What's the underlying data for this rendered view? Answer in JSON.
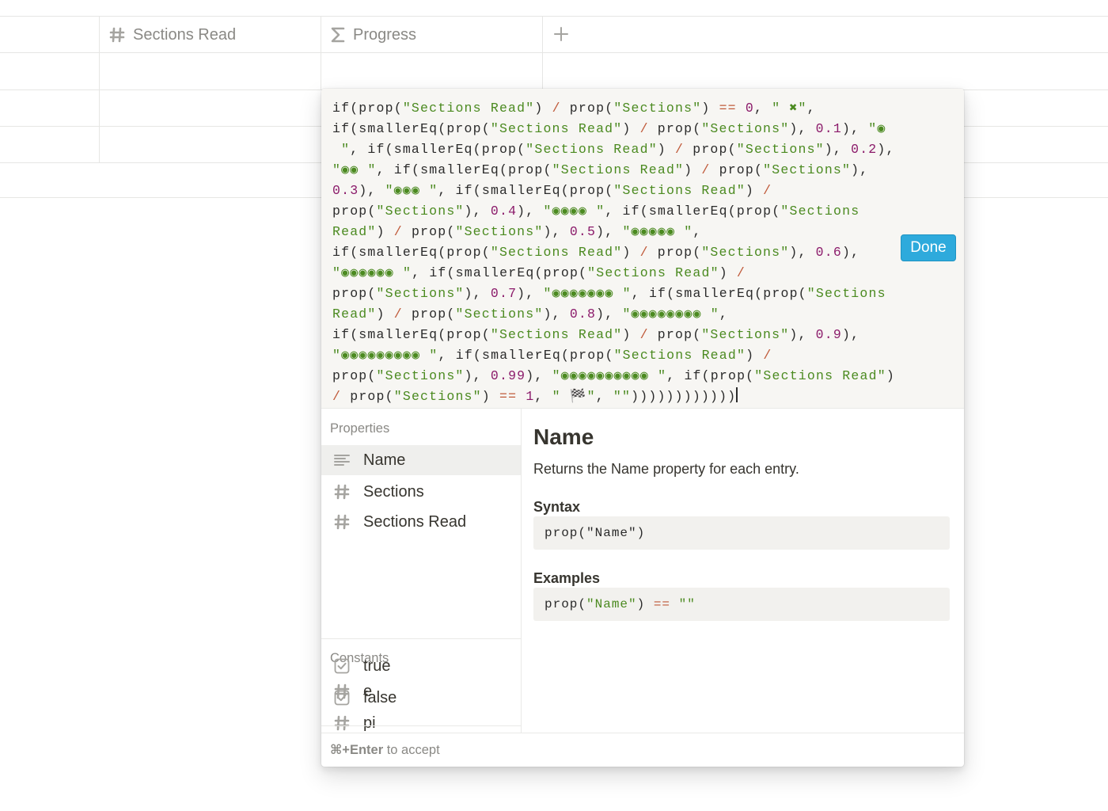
{
  "table": {
    "columns": [
      {
        "icon": "hash-icon",
        "label": "Sections Read"
      },
      {
        "icon": "sigma-icon",
        "label": "Progress"
      }
    ],
    "add_column_icon": "plus-icon"
  },
  "formula": {
    "lines": [
      [
        [
          "f",
          "if(prop("
        ],
        [
          "s",
          "\"Sections Read\""
        ],
        [
          "f",
          ") "
        ],
        [
          "o",
          "/"
        ],
        [
          "f",
          " prop("
        ],
        [
          "s",
          "\"Sections\""
        ],
        [
          "f",
          ") "
        ],
        [
          "o",
          "=="
        ],
        [
          "f",
          " "
        ],
        [
          "n",
          "0"
        ],
        [
          "f",
          ", "
        ],
        [
          "s",
          "\" ✖\""
        ],
        [
          "f",
          ","
        ]
      ],
      [
        [
          "f",
          "if(smallerEq(prop("
        ],
        [
          "s",
          "\"Sections Read\""
        ],
        [
          "f",
          ") "
        ],
        [
          "o",
          "/"
        ],
        [
          "f",
          " prop("
        ],
        [
          "s",
          "\"Sections\""
        ],
        [
          "f",
          "), "
        ],
        [
          "n",
          "0.1"
        ],
        [
          "f",
          "), "
        ],
        [
          "s",
          "\"◉"
        ]
      ],
      [
        [
          "s",
          " \""
        ],
        [
          "f",
          ", if(smallerEq(prop("
        ],
        [
          "s",
          "\"Sections Read\""
        ],
        [
          "f",
          ") "
        ],
        [
          "o",
          "/"
        ],
        [
          "f",
          " prop("
        ],
        [
          "s",
          "\"Sections\""
        ],
        [
          "f",
          "), "
        ],
        [
          "n",
          "0.2"
        ],
        [
          "f",
          "),"
        ]
      ],
      [
        [
          "s",
          "\"◉◉ \""
        ],
        [
          "f",
          ", if(smallerEq(prop("
        ],
        [
          "s",
          "\"Sections Read\""
        ],
        [
          "f",
          ") "
        ],
        [
          "o",
          "/"
        ],
        [
          "f",
          " prop("
        ],
        [
          "s",
          "\"Sections\""
        ],
        [
          "f",
          "),"
        ]
      ],
      [
        [
          "n",
          "0.3"
        ],
        [
          "f",
          "), "
        ],
        [
          "s",
          "\"◉◉◉ \""
        ],
        [
          "f",
          ", if(smallerEq(prop("
        ],
        [
          "s",
          "\"Sections Read\""
        ],
        [
          "f",
          ") "
        ],
        [
          "o",
          "/"
        ]
      ],
      [
        [
          "f",
          "prop("
        ],
        [
          "s",
          "\"Sections\""
        ],
        [
          "f",
          "), "
        ],
        [
          "n",
          "0.4"
        ],
        [
          "f",
          "), "
        ],
        [
          "s",
          "\"◉◉◉◉ \""
        ],
        [
          "f",
          ", if(smallerEq(prop("
        ],
        [
          "s",
          "\"Sections"
        ]
      ],
      [
        [
          "s",
          "Read\""
        ],
        [
          "f",
          ") "
        ],
        [
          "o",
          "/"
        ],
        [
          "f",
          " prop("
        ],
        [
          "s",
          "\"Sections\""
        ],
        [
          "f",
          "), "
        ],
        [
          "n",
          "0.5"
        ],
        [
          "f",
          "), "
        ],
        [
          "s",
          "\"◉◉◉◉◉ \""
        ],
        [
          "f",
          ","
        ]
      ],
      [
        [
          "f",
          "if(smallerEq(prop("
        ],
        [
          "s",
          "\"Sections Read\""
        ],
        [
          "f",
          ") "
        ],
        [
          "o",
          "/"
        ],
        [
          "f",
          " prop("
        ],
        [
          "s",
          "\"Sections\""
        ],
        [
          "f",
          "), "
        ],
        [
          "n",
          "0.6"
        ],
        [
          "f",
          "),"
        ]
      ],
      [
        [
          "s",
          "\"◉◉◉◉◉◉ \""
        ],
        [
          "f",
          ", if(smallerEq(prop("
        ],
        [
          "s",
          "\"Sections Read\""
        ],
        [
          "f",
          ") "
        ],
        [
          "o",
          "/"
        ]
      ],
      [
        [
          "f",
          "prop("
        ],
        [
          "s",
          "\"Sections\""
        ],
        [
          "f",
          "), "
        ],
        [
          "n",
          "0.7"
        ],
        [
          "f",
          "), "
        ],
        [
          "s",
          "\"◉◉◉◉◉◉◉ \""
        ],
        [
          "f",
          ", if(smallerEq(prop("
        ],
        [
          "s",
          "\"Sections"
        ]
      ],
      [
        [
          "s",
          "Read\""
        ],
        [
          "f",
          ") "
        ],
        [
          "o",
          "/"
        ],
        [
          "f",
          " prop("
        ],
        [
          "s",
          "\"Sections\""
        ],
        [
          "f",
          "), "
        ],
        [
          "n",
          "0.8"
        ],
        [
          "f",
          "), "
        ],
        [
          "s",
          "\"◉◉◉◉◉◉◉◉ \""
        ],
        [
          "f",
          ","
        ]
      ],
      [
        [
          "f",
          "if(smallerEq(prop("
        ],
        [
          "s",
          "\"Sections Read\""
        ],
        [
          "f",
          ") "
        ],
        [
          "o",
          "/"
        ],
        [
          "f",
          " prop("
        ],
        [
          "s",
          "\"Sections\""
        ],
        [
          "f",
          "), "
        ],
        [
          "n",
          "0.9"
        ],
        [
          "f",
          "),"
        ]
      ],
      [
        [
          "s",
          "\"◉◉◉◉◉◉◉◉◉ \""
        ],
        [
          "f",
          ", if(smallerEq(prop("
        ],
        [
          "s",
          "\"Sections Read\""
        ],
        [
          "f",
          ") "
        ],
        [
          "o",
          "/"
        ]
      ],
      [
        [
          "f",
          "prop("
        ],
        [
          "s",
          "\"Sections\""
        ],
        [
          "f",
          "), "
        ],
        [
          "n",
          "0.99"
        ],
        [
          "f",
          "), "
        ],
        [
          "s",
          "\"◉◉◉◉◉◉◉◉◉◉ \""
        ],
        [
          "f",
          ", if(prop("
        ],
        [
          "s",
          "\"Sections Read\""
        ],
        [
          "f",
          ")"
        ]
      ],
      [
        [
          "o",
          "/"
        ],
        [
          "f",
          " prop("
        ],
        [
          "s",
          "\"Sections\""
        ],
        [
          "f",
          ") "
        ],
        [
          "o",
          "=="
        ],
        [
          "f",
          " "
        ],
        [
          "n",
          "1"
        ],
        [
          "f",
          ", "
        ],
        [
          "s",
          "\" 🏁\""
        ],
        [
          "f",
          ", "
        ],
        [
          "s",
          "\"\""
        ],
        [
          "f",
          "))))))))))))"
        ]
      ]
    ]
  },
  "done_label": "Done",
  "sidebar": {
    "properties_label": "Properties",
    "properties": [
      {
        "icon": "text-lines-icon",
        "label": "Name",
        "selected": true
      },
      {
        "icon": "hash-icon",
        "label": "Sections"
      },
      {
        "icon": "hash-icon",
        "label": "Sections Read"
      }
    ],
    "constants_label": "Constants",
    "constants": [
      {
        "icon": "hash-icon",
        "label": "e"
      },
      {
        "icon": "hash-icon",
        "label": "pi"
      },
      {
        "icon": "checkbox-icon",
        "label": "true"
      },
      {
        "icon": "checkbox-icon",
        "label": "false"
      }
    ]
  },
  "help": {
    "title": "Name",
    "description": "Returns the Name property for each entry.",
    "syntax_label": "Syntax",
    "syntax_code": "prop(\"Name\")",
    "examples_label": "Examples",
    "example_code_prefix": "prop(",
    "example_code_arg": "\"Name\"",
    "example_code_close": ") ",
    "example_code_op": "==",
    "example_code_rest": " \"\""
  },
  "footer": {
    "shortcut": "⌘+Enter",
    "text": " to accept"
  }
}
